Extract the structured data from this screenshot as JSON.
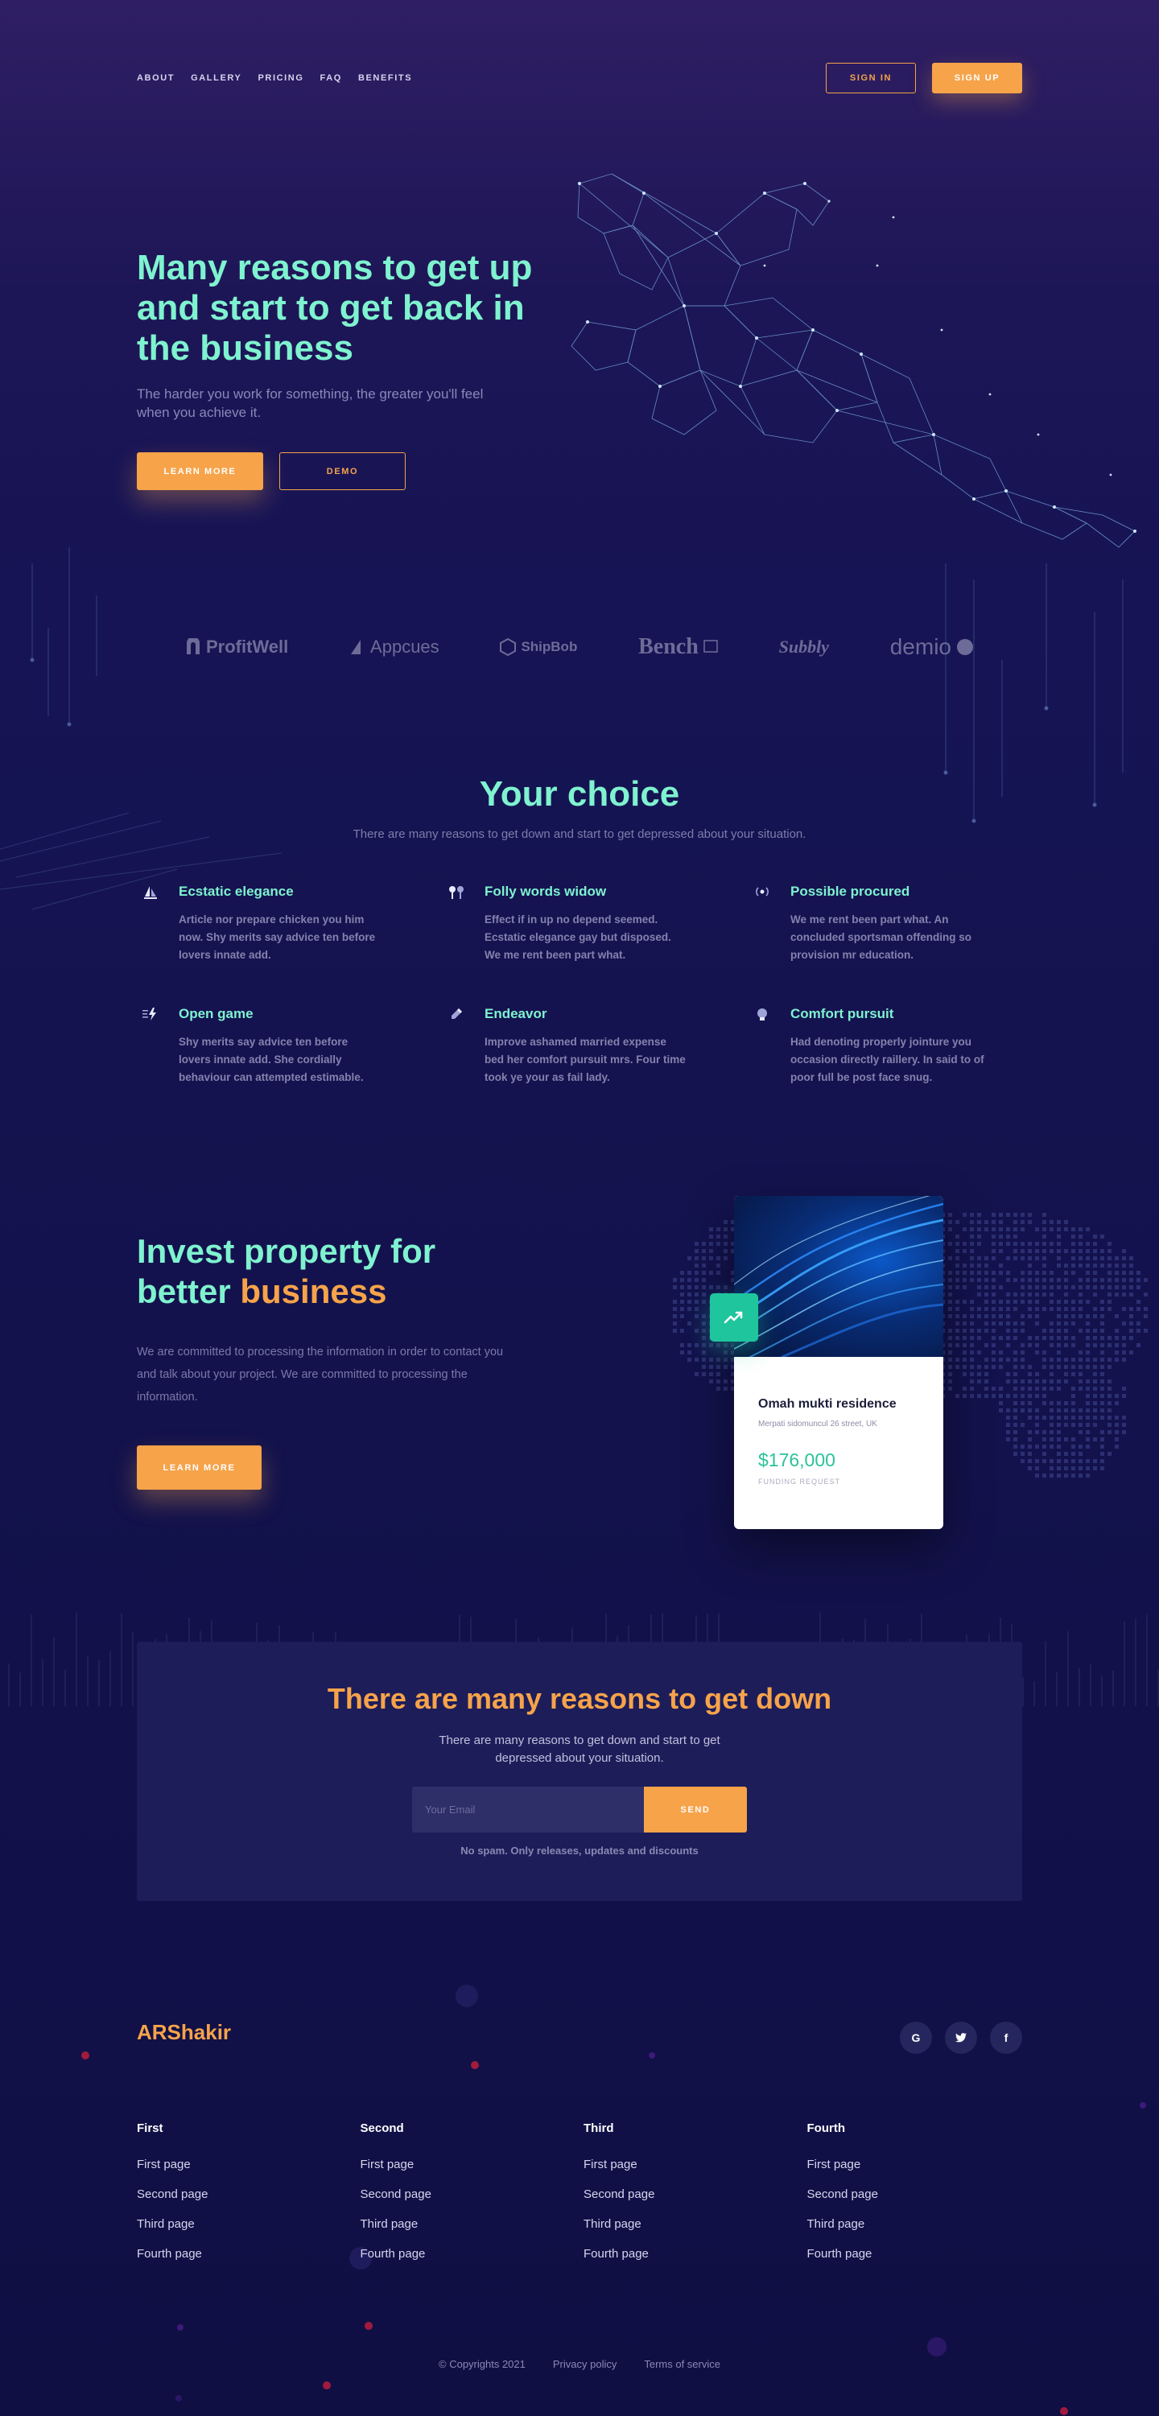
{
  "nav": {
    "links": [
      "ABOUT",
      "GALLERY",
      "PRICING",
      "FAQ",
      "BENEFITS"
    ],
    "sign_in": "SIGN IN",
    "sign_up": "SIGN UP"
  },
  "hero": {
    "title": "Many reasons to get up and start to get back in the business",
    "subtitle": "The harder you work for something, the greater you'll feel when you achieve it.",
    "primary_button": "LEARN MORE",
    "secondary_button": "DEMO"
  },
  "logos": [
    "ProfitWell",
    "Appcues",
    "ShipBob",
    "Bench",
    "Subbly",
    "demio"
  ],
  "features_section": {
    "title": "Your choice",
    "subtitle": "There are many reasons to get down and start to get depressed about your situation.",
    "items": [
      {
        "icon": "sailboat-icon",
        "title": "Ecstatic elegance",
        "text": "Article nor prepare chicken you him now. Shy merits say advice ten before lovers innate add."
      },
      {
        "icon": "pins-icon",
        "title": "Folly words widow",
        "text": "Effect if in up no depend seemed. Ecstatic elegance gay but disposed. We me rent been part what."
      },
      {
        "icon": "broadcast-icon",
        "title": "Possible procured",
        "text": "We me rent been part what. An concluded sportsman offending so provision mr education."
      },
      {
        "icon": "bolt-icon",
        "title": "Open game",
        "text": "Shy merits say advice ten before lovers innate add. She cordially behaviour can attempted estimable."
      },
      {
        "icon": "pen-icon",
        "title": "Endeavor",
        "text": "Improve ashamed married expense bed her comfort pursuit mrs. Four time took ye your as fail lady."
      },
      {
        "icon": "lightbulb-icon",
        "title": "Comfort pursuit",
        "text": "Had denoting properly jointure you occasion directly raillery. In said to of poor full be post face snug."
      }
    ]
  },
  "invest": {
    "title_part1": "Invest property for better ",
    "title_accent": "business",
    "text": "We are committed to processing the information in order to contact you and talk about your project. We are committed to processing the information.",
    "button": "LEARN MORE",
    "card": {
      "name": "Omah mukti residence",
      "address": "Merpati sidomuncul 26 street, UK",
      "price": "$176,000",
      "label": "FUNDING REQUEST"
    }
  },
  "subscribe": {
    "title": "There are many reasons to get down",
    "text": "There are many reasons to get down and start to get depressed about your situation.",
    "placeholder": "Your Email",
    "button": "SEND",
    "note": "No spam. Only releases, updates and discounts"
  },
  "footer": {
    "brand": "ARShakir",
    "socials": [
      "G",
      "twitter",
      "f"
    ],
    "columns": [
      {
        "title": "First",
        "links": [
          "First page",
          "Second page",
          "Third page",
          "Fourth page"
        ]
      },
      {
        "title": "Second",
        "links": [
          "First page",
          "Second page",
          "Third page",
          "Fourth page"
        ]
      },
      {
        "title": "Third",
        "links": [
          "First page",
          "Second page",
          "Third page",
          "Fourth page"
        ]
      },
      {
        "title": "Fourth",
        "links": [
          "First page",
          "Second page",
          "Third page",
          "Fourth page"
        ]
      }
    ],
    "copyright": "© Copyrights 2021",
    "privacy": "Privacy policy",
    "terms": "Terms of service"
  },
  "colors": {
    "accent": "#f6a34a",
    "mint": "#7ff2cf",
    "background": "#14134f"
  }
}
